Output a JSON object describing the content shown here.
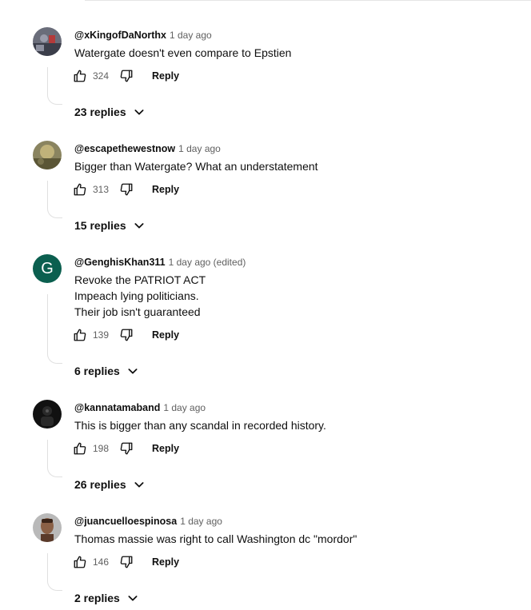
{
  "comments": [
    {
      "author": "@xKingofDaNorthx",
      "time": "1 day ago",
      "lines": [
        "Watergate doesn't even compare to Epstien"
      ],
      "likes": "324",
      "reply_label": "Reply",
      "replies_label": "23 replies",
      "avatar_icon": "photo-avatar",
      "avatar_colors": [
        "#6a6d7a",
        "#3b3e4a",
        "#b33a3a"
      ]
    },
    {
      "author": "@escapethewestnow",
      "time": "1 day ago",
      "lines": [
        "Bigger than Watergate? What an understatement"
      ],
      "likes": "313",
      "reply_label": "Reply",
      "replies_label": "15 replies",
      "avatar_icon": "photo-avatar",
      "avatar_colors": [
        "#8a8460",
        "#5b5636",
        "#c0b27a"
      ]
    },
    {
      "author": "@GenghisKhan311",
      "time": "1 day ago (edited)",
      "lines": [
        "Revoke the PATRIOT ACT",
        "Impeach lying politicians.",
        "Their job isn't guaranteed"
      ],
      "likes": "139",
      "reply_label": "Reply",
      "replies_label": "6 replies",
      "avatar_letter": "G",
      "avatar_colors": [
        "#0b5f4f"
      ]
    },
    {
      "author": "@kannatamaband",
      "time": "1 day ago",
      "lines": [
        "This is bigger than any scandal in recorded history."
      ],
      "likes": "198",
      "reply_label": "Reply",
      "replies_label": "26 replies",
      "avatar_icon": "photo-avatar",
      "avatar_colors": [
        "#111111",
        "#2a2a2a",
        "#555555"
      ]
    },
    {
      "author": "@juancuelloespinosa",
      "time": "1 day ago",
      "lines": [
        "Thomas massie was right to call Washington dc \"mordor\""
      ],
      "likes": "146",
      "reply_label": "Reply",
      "replies_label": "2 replies",
      "avatar_icon": "photo-avatar",
      "avatar_colors": [
        "#b9b9b9",
        "#5a3a2a",
        "#8a6046"
      ]
    }
  ],
  "icons": {
    "like": "thumb-up-icon",
    "dislike": "thumb-down-icon",
    "expand": "chevron-down-icon"
  }
}
